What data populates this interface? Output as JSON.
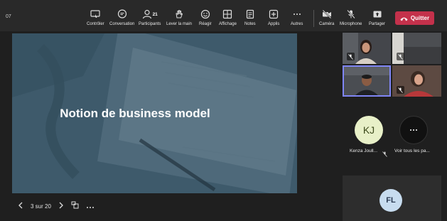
{
  "timer": "07",
  "toolbar": {
    "items": [
      {
        "label": "Contrôler",
        "icon": "share-control-icon"
      },
      {
        "label": "Conversation",
        "icon": "chat-icon"
      },
      {
        "label": "Participants",
        "icon": "people-icon",
        "badge": "21"
      },
      {
        "label": "Lever la main",
        "icon": "raise-hand-icon"
      },
      {
        "label": "Réagir",
        "icon": "smile-icon"
      },
      {
        "label": "Affichage",
        "icon": "grid-view-icon"
      },
      {
        "label": "Notes",
        "icon": "notes-icon"
      },
      {
        "label": "Applis",
        "icon": "add-app-icon"
      },
      {
        "label": "Autres",
        "icon": "more-icon"
      },
      {
        "label": "Caméra",
        "icon": "camera-off-icon"
      },
      {
        "label": "Microphone",
        "icon": "mic-off-icon"
      },
      {
        "label": "Partager",
        "icon": "share-icon"
      }
    ],
    "quit_label": "Quitter",
    "quit_color": "#c4314b"
  },
  "slide": {
    "title": "Notion de business model",
    "counter": "3 sur 20"
  },
  "participants": {
    "kj": {
      "initials": "KJ",
      "name": "Kenza Joull..."
    },
    "more": {
      "label": "Voir tous les pa..."
    },
    "fl": {
      "initials": "FL"
    }
  }
}
